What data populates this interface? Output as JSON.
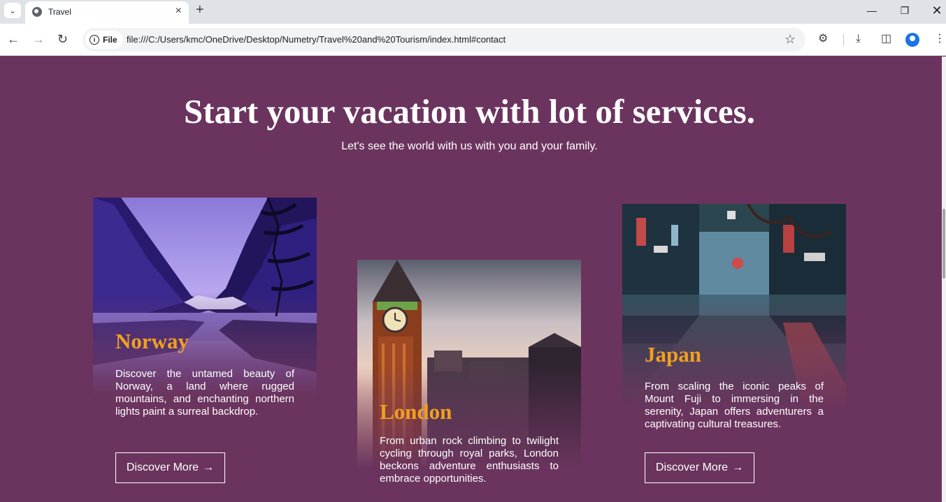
{
  "browser": {
    "tab_title": "Travel",
    "site_chip": "File",
    "url": "file:///C:/Users/kmc/OneDrive/Desktop/Numetry/Travel%20and%20Tourism/index.html#contact"
  },
  "hero": {
    "title": "Start your vacation with lot of services.",
    "subtitle": "Let's see the world with us with you and your family."
  },
  "cards": [
    {
      "title": "Norway",
      "text": "Discover the untamed beauty of Norway, a land where rugged mountains, and enchanting northern lights paint a surreal backdrop.",
      "button": "Discover More"
    },
    {
      "title": "London",
      "text": "From urban rock climbing to twilight cycling through royal parks, London beckons adventure enthusiasts to embrace opportunities."
    },
    {
      "title": "Japan",
      "text": "From scaling the iconic peaks of Mount Fuji to immersing in the serenity, Japan offers adventurers a captivating cultural treasures.",
      "button": "Discover More"
    }
  ],
  "colors": {
    "page_background": "#6b345e",
    "card_title": "#f0a020",
    "text": "#ffffff"
  }
}
